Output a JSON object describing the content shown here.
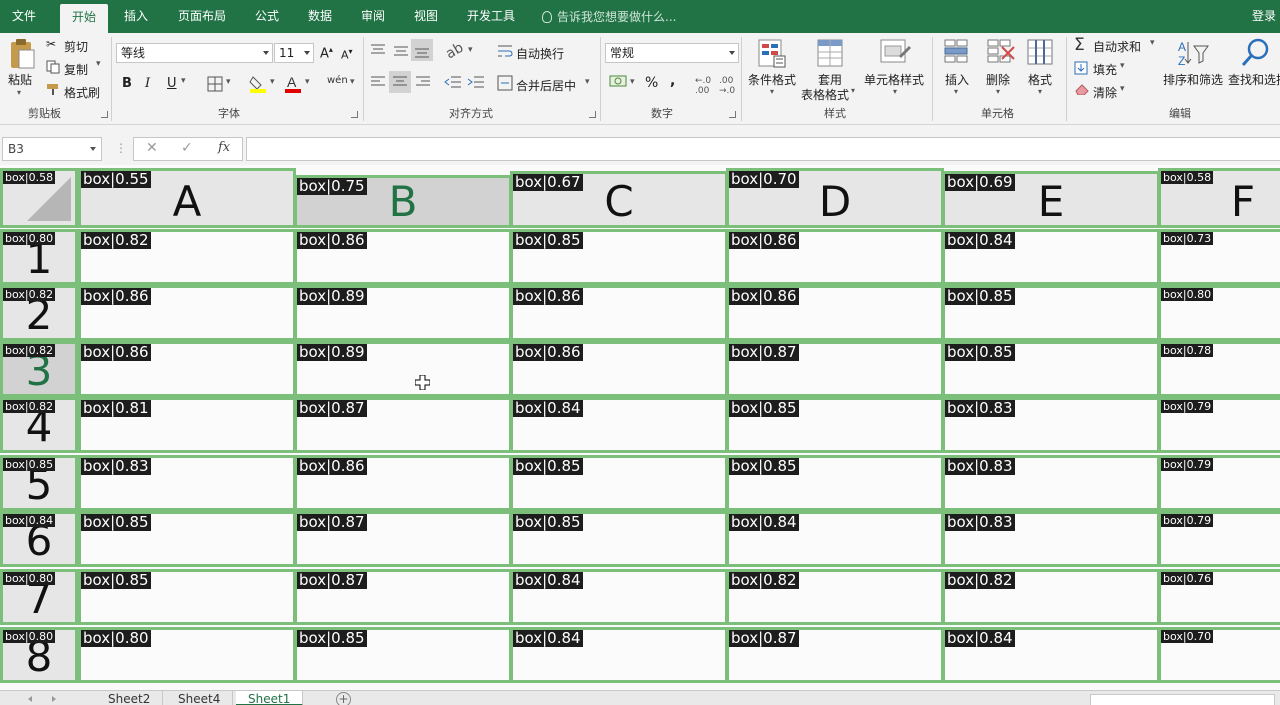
{
  "menu": {
    "file": "文件",
    "home": "开始",
    "insert": "插入",
    "page_layout": "页面布局",
    "formulas": "公式",
    "data": "数据",
    "review": "审阅",
    "view": "视图",
    "developer": "开发工具",
    "tell_me": "告诉我您想要做什么...",
    "login": "登录"
  },
  "ribbon": {
    "clipboard": {
      "paste": "粘贴",
      "cut": "剪切",
      "copy": "复制",
      "format_painter": "格式刷",
      "label": "剪贴板"
    },
    "font": {
      "font_name": "等线",
      "font_size": "11",
      "bold": "B",
      "italic": "I",
      "underline": "U",
      "wen": "wén",
      "label": "字体"
    },
    "alignment": {
      "wrap_text": "自动换行",
      "merge_center": "合并后居中",
      "label": "对齐方式"
    },
    "number": {
      "format": "常规",
      "percent": "%",
      "comma": ",",
      "label": "数字"
    },
    "styles": {
      "conditional": "条件格式",
      "table_line1": "套用",
      "table_line2": "表格格式",
      "cell_styles": "单元格样式",
      "label": "样式"
    },
    "cells": {
      "insert": "插入",
      "delete": "删除",
      "format": "格式",
      "label": "单元格"
    },
    "editing": {
      "autosum": "自动求和",
      "fill": "填充",
      "clear": "清除",
      "sort_filter": "排序和筛选",
      "find_select": "查找和选择",
      "label": "编辑"
    }
  },
  "formula_bar": {
    "name_box": "B3",
    "cancel": "✕",
    "enter": "✓",
    "fx": "fx",
    "formula": ""
  },
  "grid": {
    "corner_tag": "box|0.58",
    "columns": [
      {
        "letter": "A",
        "tag": "box|0.55"
      },
      {
        "letter": "B",
        "tag": "box|0.75"
      },
      {
        "letter": "C",
        "tag": "box|0.67"
      },
      {
        "letter": "D",
        "tag": "box|0.70"
      },
      {
        "letter": "E",
        "tag": "box|0.69"
      },
      {
        "letter": "F",
        "tag": "box|0.58"
      }
    ],
    "rows": [
      {
        "num": "1",
        "tag": "box|0.80",
        "cells": [
          "box|0.82",
          "box|0.86",
          "box|0.85",
          "box|0.86",
          "box|0.84",
          "box|0.73"
        ]
      },
      {
        "num": "2",
        "tag": "box|0.82",
        "cells": [
          "box|0.86",
          "box|0.89",
          "box|0.86",
          "box|0.86",
          "box|0.85",
          "box|0.80"
        ]
      },
      {
        "num": "3",
        "tag": "box|0.82",
        "cells": [
          "box|0.86",
          "box|0.89",
          "box|0.86",
          "box|0.87",
          "box|0.85",
          "box|0.78"
        ]
      },
      {
        "num": "4",
        "tag": "box|0.82",
        "cells": [
          "box|0.81",
          "box|0.87",
          "box|0.84",
          "box|0.85",
          "box|0.83",
          "box|0.79"
        ]
      },
      {
        "num": "5",
        "tag": "box|0.85",
        "cells": [
          "box|0.83",
          "box|0.86",
          "box|0.85",
          "box|0.85",
          "box|0.83",
          "box|0.79"
        ]
      },
      {
        "num": "6",
        "tag": "box|0.84",
        "cells": [
          "box|0.85",
          "box|0.87",
          "box|0.85",
          "box|0.84",
          "box|0.83",
          "box|0.79"
        ]
      },
      {
        "num": "7",
        "tag": "box|0.80",
        "cells": [
          "box|0.85",
          "box|0.87",
          "box|0.84",
          "box|0.82",
          "box|0.82",
          "box|0.76"
        ]
      },
      {
        "num": "8",
        "tag": "box|0.80",
        "cells": [
          "box|0.80",
          "box|0.85",
          "box|0.84",
          "box|0.87",
          "box|0.84",
          "box|0.70"
        ]
      }
    ]
  },
  "sheets": {
    "tabs": [
      "Sheet2",
      "Sheet4",
      "Sheet1"
    ],
    "add": "+"
  },
  "colors": {
    "brand": "#217346",
    "box_border": "#7bbf7a",
    "tag_bg": "#1d1d1d"
  }
}
